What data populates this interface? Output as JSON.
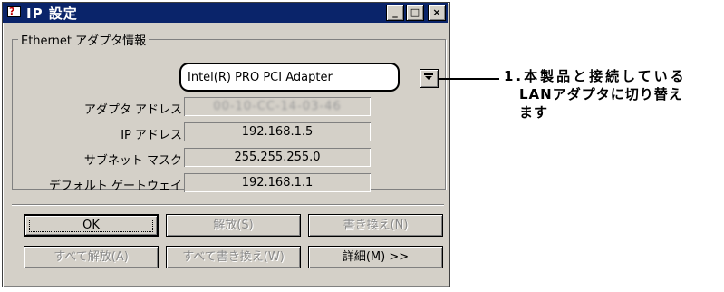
{
  "window": {
    "title": "IP 設定",
    "controls": {
      "minimize": "_",
      "maximize": "□",
      "close": "×"
    }
  },
  "group": {
    "label": "Ethernet アダプタ情報",
    "adapter_select": {
      "value": "Intel(R) PRO PCI Adapter"
    },
    "rows": [
      {
        "label": "アダプタ アドレス",
        "value": "00-10-CC-14-03-46"
      },
      {
        "label": "IP アドレス",
        "value": "192.168.1.5"
      },
      {
        "label": "サブネット マスク",
        "value": "255.255.255.0"
      },
      {
        "label": "デフォルト ゲートウェイ",
        "value": "192.168.1.1"
      }
    ]
  },
  "buttons": {
    "ok": "OK",
    "release": "解放(S)",
    "renew": "書き換え(N)",
    "release_all": "すべて解放(A)",
    "renew_all": "すべて書き換え(W)",
    "details": "詳細(M) >>"
  },
  "callout": {
    "line1": "1.本製品と接続している",
    "line2": "LANアダプタに切り替え",
    "line3": "ます"
  }
}
